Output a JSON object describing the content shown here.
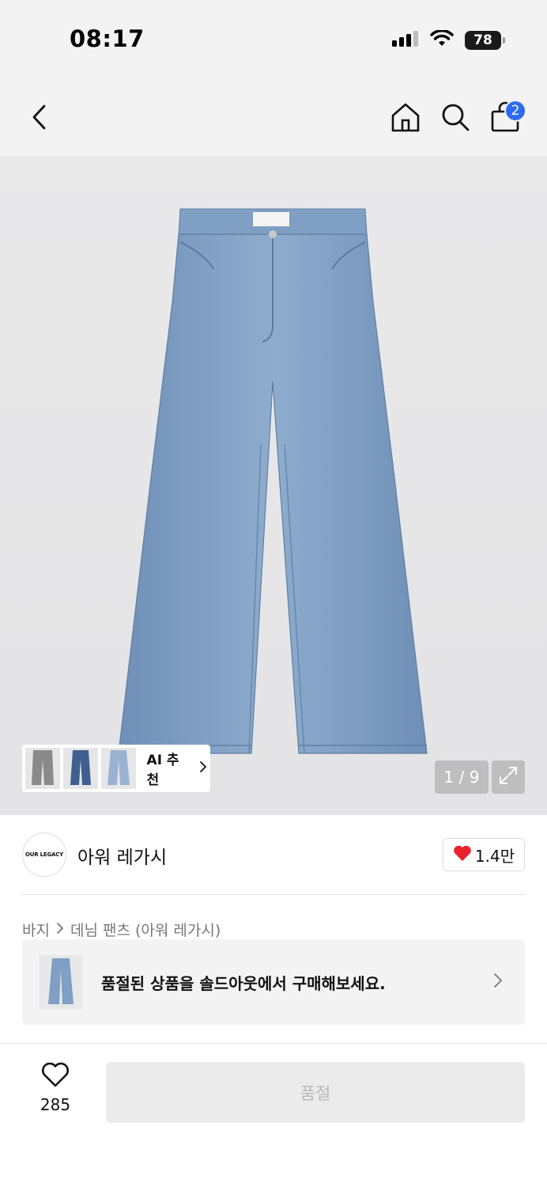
{
  "status_bar": {
    "time": "08:17",
    "battery": "78"
  },
  "nav": {
    "cart_count": "2"
  },
  "gallery": {
    "ai_label": "AI 추천",
    "counter": "1 / 9"
  },
  "brand": {
    "logo_text": "OUR LEGACY",
    "name": "아워 레가시",
    "likes": "1.4만"
  },
  "breadcrumb": {
    "category": "바지",
    "subcategory": "데님 팬츠 (아워 레가시)"
  },
  "soldout_banner": {
    "text": "품절된 상품을 솔드아웃에서 구매해보세요."
  },
  "bottom_bar": {
    "wish_count": "285",
    "buy_label": "품절"
  },
  "colors": {
    "badge": "#2e6bf0",
    "heart": "#e8232e",
    "denim": "#7e9fc4"
  }
}
